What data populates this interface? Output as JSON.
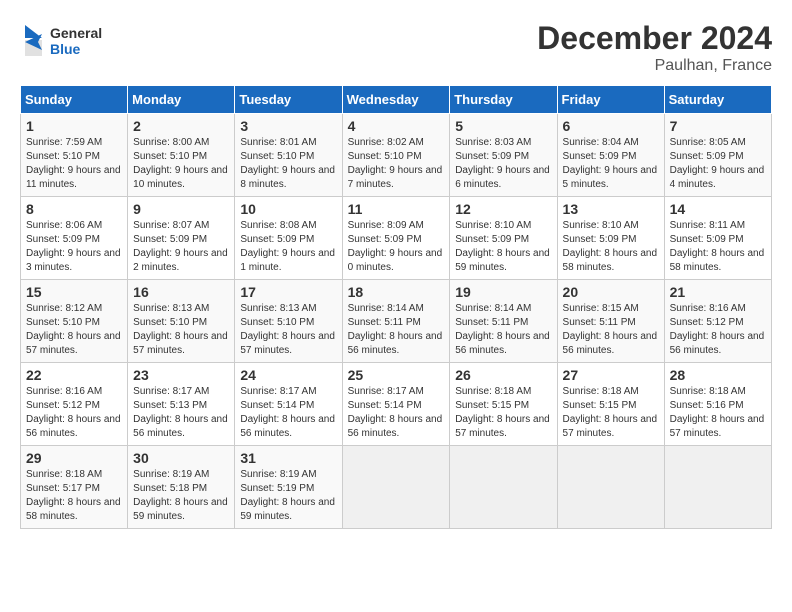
{
  "header": {
    "logo_general": "General",
    "logo_blue": "Blue",
    "month_title": "December 2024",
    "subtitle": "Paulhan, France"
  },
  "weekdays": [
    "Sunday",
    "Monday",
    "Tuesday",
    "Wednesday",
    "Thursday",
    "Friday",
    "Saturday"
  ],
  "weeks": [
    [
      {
        "day": "1",
        "sunrise": "Sunrise: 7:59 AM",
        "sunset": "Sunset: 5:10 PM",
        "daylight": "Daylight: 9 hours and 11 minutes."
      },
      {
        "day": "2",
        "sunrise": "Sunrise: 8:00 AM",
        "sunset": "Sunset: 5:10 PM",
        "daylight": "Daylight: 9 hours and 10 minutes."
      },
      {
        "day": "3",
        "sunrise": "Sunrise: 8:01 AM",
        "sunset": "Sunset: 5:10 PM",
        "daylight": "Daylight: 9 hours and 8 minutes."
      },
      {
        "day": "4",
        "sunrise": "Sunrise: 8:02 AM",
        "sunset": "Sunset: 5:10 PM",
        "daylight": "Daylight: 9 hours and 7 minutes."
      },
      {
        "day": "5",
        "sunrise": "Sunrise: 8:03 AM",
        "sunset": "Sunset: 5:09 PM",
        "daylight": "Daylight: 9 hours and 6 minutes."
      },
      {
        "day": "6",
        "sunrise": "Sunrise: 8:04 AM",
        "sunset": "Sunset: 5:09 PM",
        "daylight": "Daylight: 9 hours and 5 minutes."
      },
      {
        "day": "7",
        "sunrise": "Sunrise: 8:05 AM",
        "sunset": "Sunset: 5:09 PM",
        "daylight": "Daylight: 9 hours and 4 minutes."
      }
    ],
    [
      {
        "day": "8",
        "sunrise": "Sunrise: 8:06 AM",
        "sunset": "Sunset: 5:09 PM",
        "daylight": "Daylight: 9 hours and 3 minutes."
      },
      {
        "day": "9",
        "sunrise": "Sunrise: 8:07 AM",
        "sunset": "Sunset: 5:09 PM",
        "daylight": "Daylight: 9 hours and 2 minutes."
      },
      {
        "day": "10",
        "sunrise": "Sunrise: 8:08 AM",
        "sunset": "Sunset: 5:09 PM",
        "daylight": "Daylight: 9 hours and 1 minute."
      },
      {
        "day": "11",
        "sunrise": "Sunrise: 8:09 AM",
        "sunset": "Sunset: 5:09 PM",
        "daylight": "Daylight: 9 hours and 0 minutes."
      },
      {
        "day": "12",
        "sunrise": "Sunrise: 8:10 AM",
        "sunset": "Sunset: 5:09 PM",
        "daylight": "Daylight: 8 hours and 59 minutes."
      },
      {
        "day": "13",
        "sunrise": "Sunrise: 8:10 AM",
        "sunset": "Sunset: 5:09 PM",
        "daylight": "Daylight: 8 hours and 58 minutes."
      },
      {
        "day": "14",
        "sunrise": "Sunrise: 8:11 AM",
        "sunset": "Sunset: 5:09 PM",
        "daylight": "Daylight: 8 hours and 58 minutes."
      }
    ],
    [
      {
        "day": "15",
        "sunrise": "Sunrise: 8:12 AM",
        "sunset": "Sunset: 5:10 PM",
        "daylight": "Daylight: 8 hours and 57 minutes."
      },
      {
        "day": "16",
        "sunrise": "Sunrise: 8:13 AM",
        "sunset": "Sunset: 5:10 PM",
        "daylight": "Daylight: 8 hours and 57 minutes."
      },
      {
        "day": "17",
        "sunrise": "Sunrise: 8:13 AM",
        "sunset": "Sunset: 5:10 PM",
        "daylight": "Daylight: 8 hours and 57 minutes."
      },
      {
        "day": "18",
        "sunrise": "Sunrise: 8:14 AM",
        "sunset": "Sunset: 5:11 PM",
        "daylight": "Daylight: 8 hours and 56 minutes."
      },
      {
        "day": "19",
        "sunrise": "Sunrise: 8:14 AM",
        "sunset": "Sunset: 5:11 PM",
        "daylight": "Daylight: 8 hours and 56 minutes."
      },
      {
        "day": "20",
        "sunrise": "Sunrise: 8:15 AM",
        "sunset": "Sunset: 5:11 PM",
        "daylight": "Daylight: 8 hours and 56 minutes."
      },
      {
        "day": "21",
        "sunrise": "Sunrise: 8:16 AM",
        "sunset": "Sunset: 5:12 PM",
        "daylight": "Daylight: 8 hours and 56 minutes."
      }
    ],
    [
      {
        "day": "22",
        "sunrise": "Sunrise: 8:16 AM",
        "sunset": "Sunset: 5:12 PM",
        "daylight": "Daylight: 8 hours and 56 minutes."
      },
      {
        "day": "23",
        "sunrise": "Sunrise: 8:17 AM",
        "sunset": "Sunset: 5:13 PM",
        "daylight": "Daylight: 8 hours and 56 minutes."
      },
      {
        "day": "24",
        "sunrise": "Sunrise: 8:17 AM",
        "sunset": "Sunset: 5:14 PM",
        "daylight": "Daylight: 8 hours and 56 minutes."
      },
      {
        "day": "25",
        "sunrise": "Sunrise: 8:17 AM",
        "sunset": "Sunset: 5:14 PM",
        "daylight": "Daylight: 8 hours and 56 minutes."
      },
      {
        "day": "26",
        "sunrise": "Sunrise: 8:18 AM",
        "sunset": "Sunset: 5:15 PM",
        "daylight": "Daylight: 8 hours and 57 minutes."
      },
      {
        "day": "27",
        "sunrise": "Sunrise: 8:18 AM",
        "sunset": "Sunset: 5:15 PM",
        "daylight": "Daylight: 8 hours and 57 minutes."
      },
      {
        "day": "28",
        "sunrise": "Sunrise: 8:18 AM",
        "sunset": "Sunset: 5:16 PM",
        "daylight": "Daylight: 8 hours and 57 minutes."
      }
    ],
    [
      {
        "day": "29",
        "sunrise": "Sunrise: 8:18 AM",
        "sunset": "Sunset: 5:17 PM",
        "daylight": "Daylight: 8 hours and 58 minutes."
      },
      {
        "day": "30",
        "sunrise": "Sunrise: 8:19 AM",
        "sunset": "Sunset: 5:18 PM",
        "daylight": "Daylight: 8 hours and 59 minutes."
      },
      {
        "day": "31",
        "sunrise": "Sunrise: 8:19 AM",
        "sunset": "Sunset: 5:19 PM",
        "daylight": "Daylight: 8 hours and 59 minutes."
      },
      null,
      null,
      null,
      null
    ]
  ]
}
